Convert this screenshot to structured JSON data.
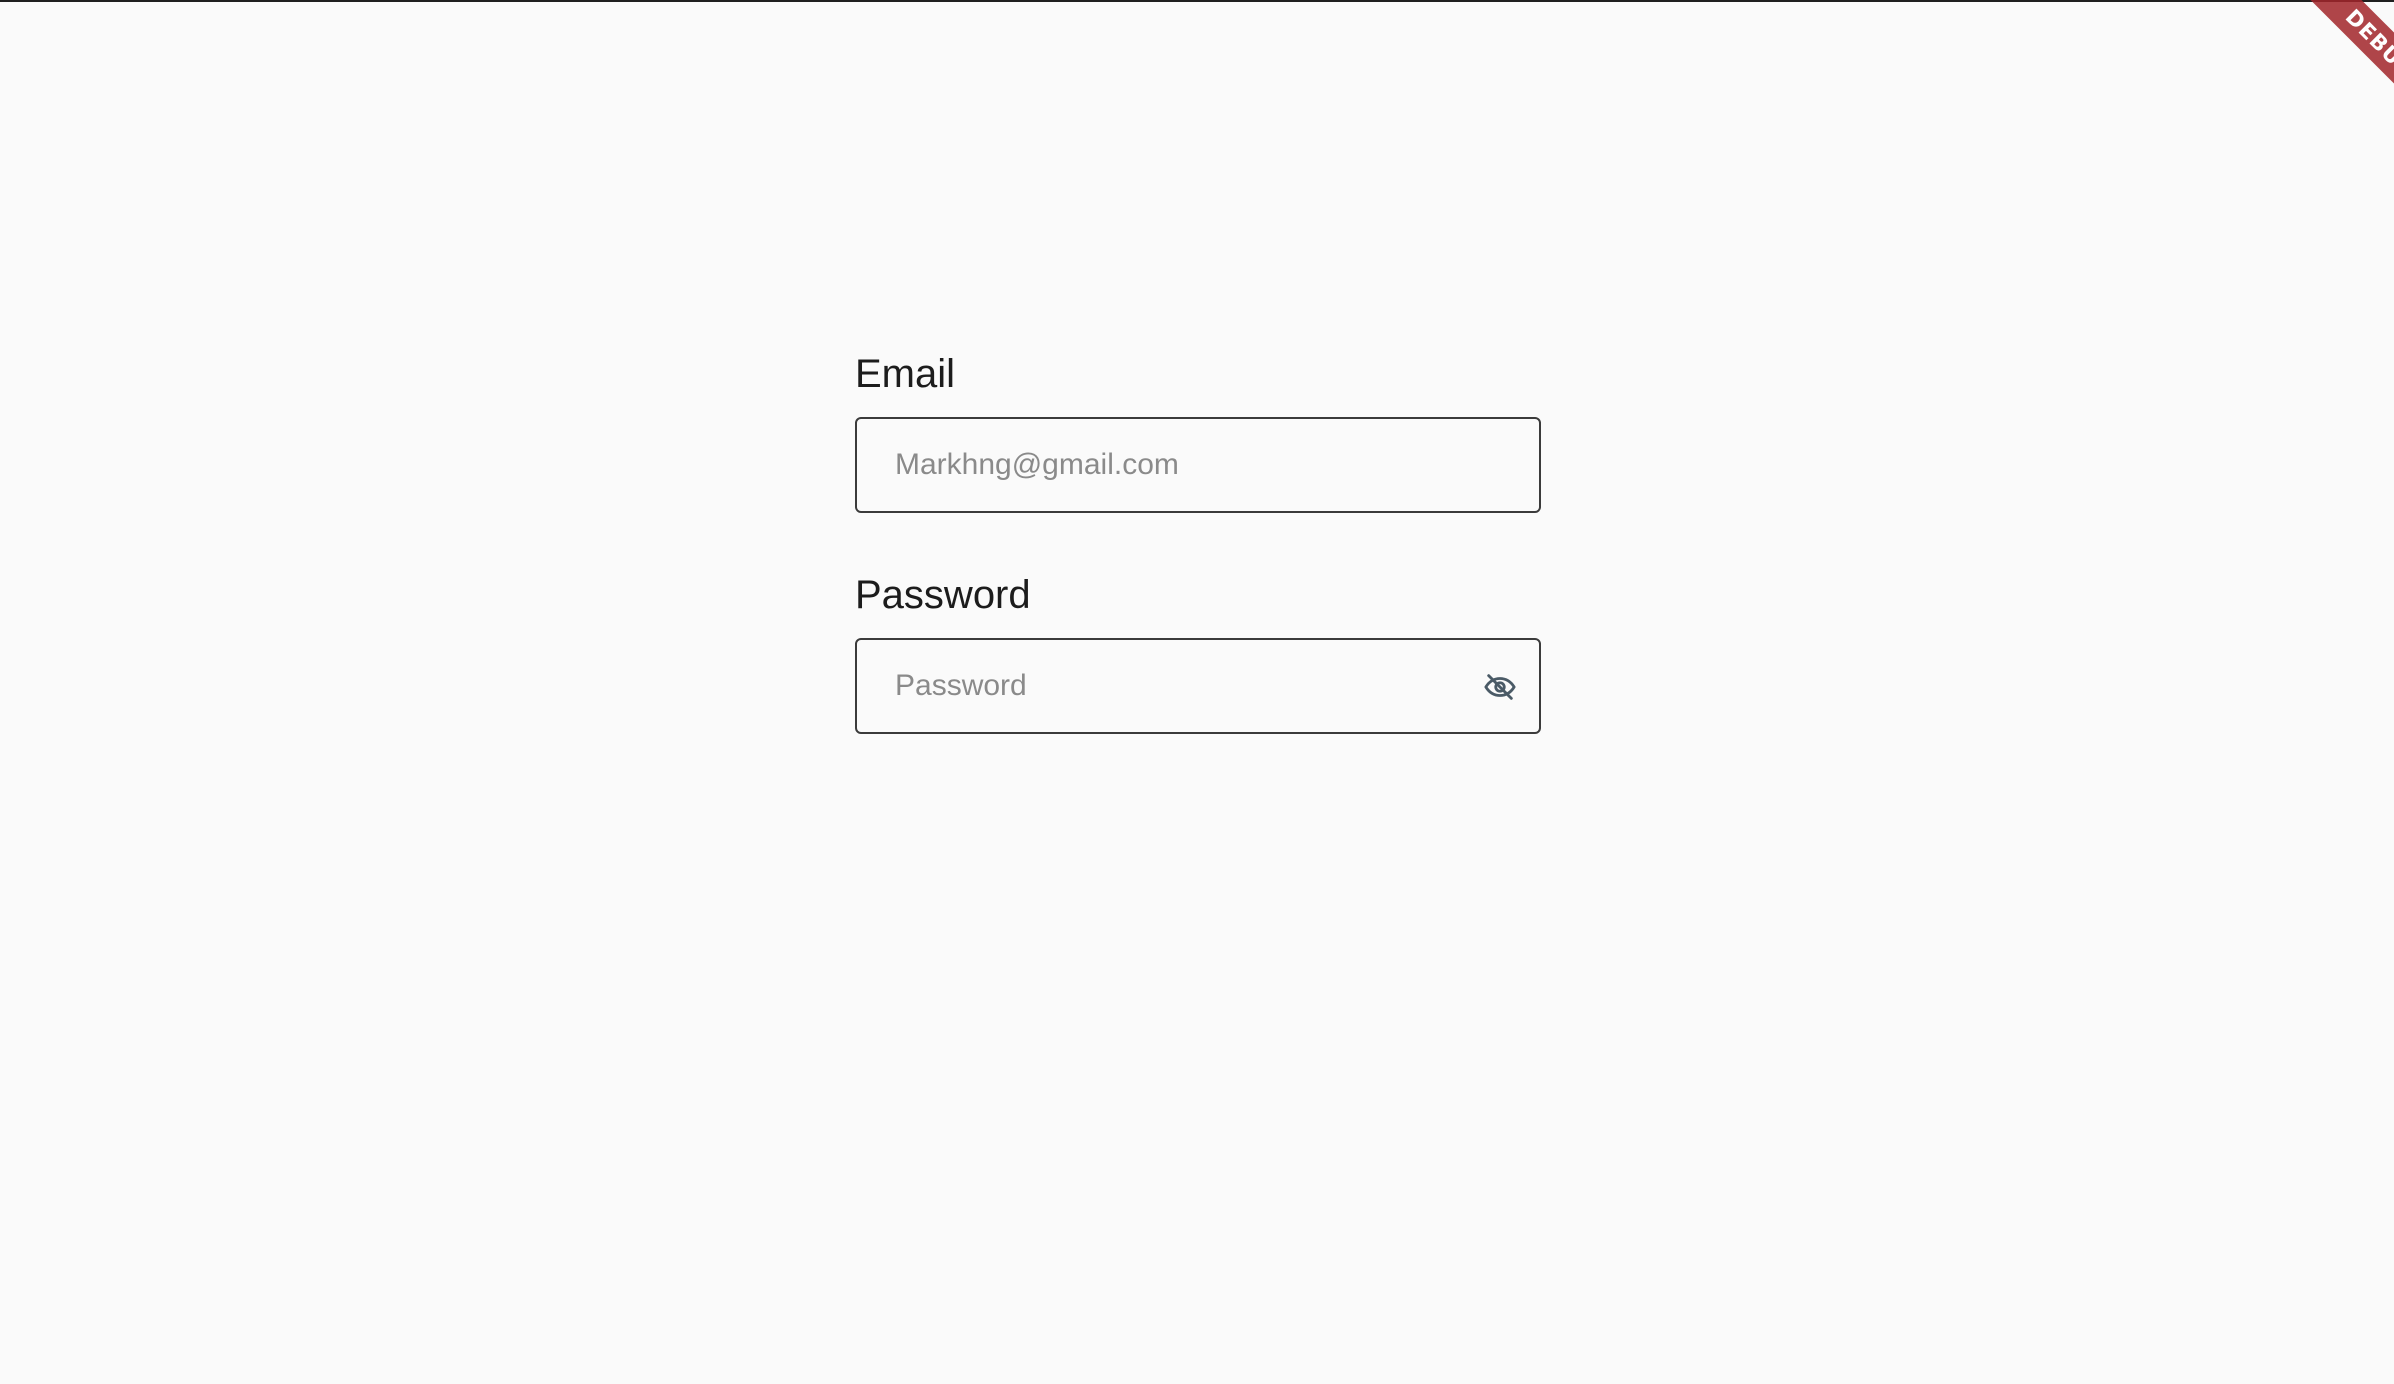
{
  "form": {
    "email": {
      "label": "Email",
      "placeholder": "Markhng@gmail.com",
      "value": ""
    },
    "password": {
      "label": "Password",
      "placeholder": "Password",
      "value": "",
      "toggle_icon": "eye-off-icon"
    }
  },
  "debug_banner": {
    "text": "DEBUG",
    "color": "#a3262b"
  },
  "colors": {
    "background": "#fafafa",
    "border": "#3b3b3b",
    "placeholder": "#8a8a8a",
    "icon": "#4a5a66"
  }
}
